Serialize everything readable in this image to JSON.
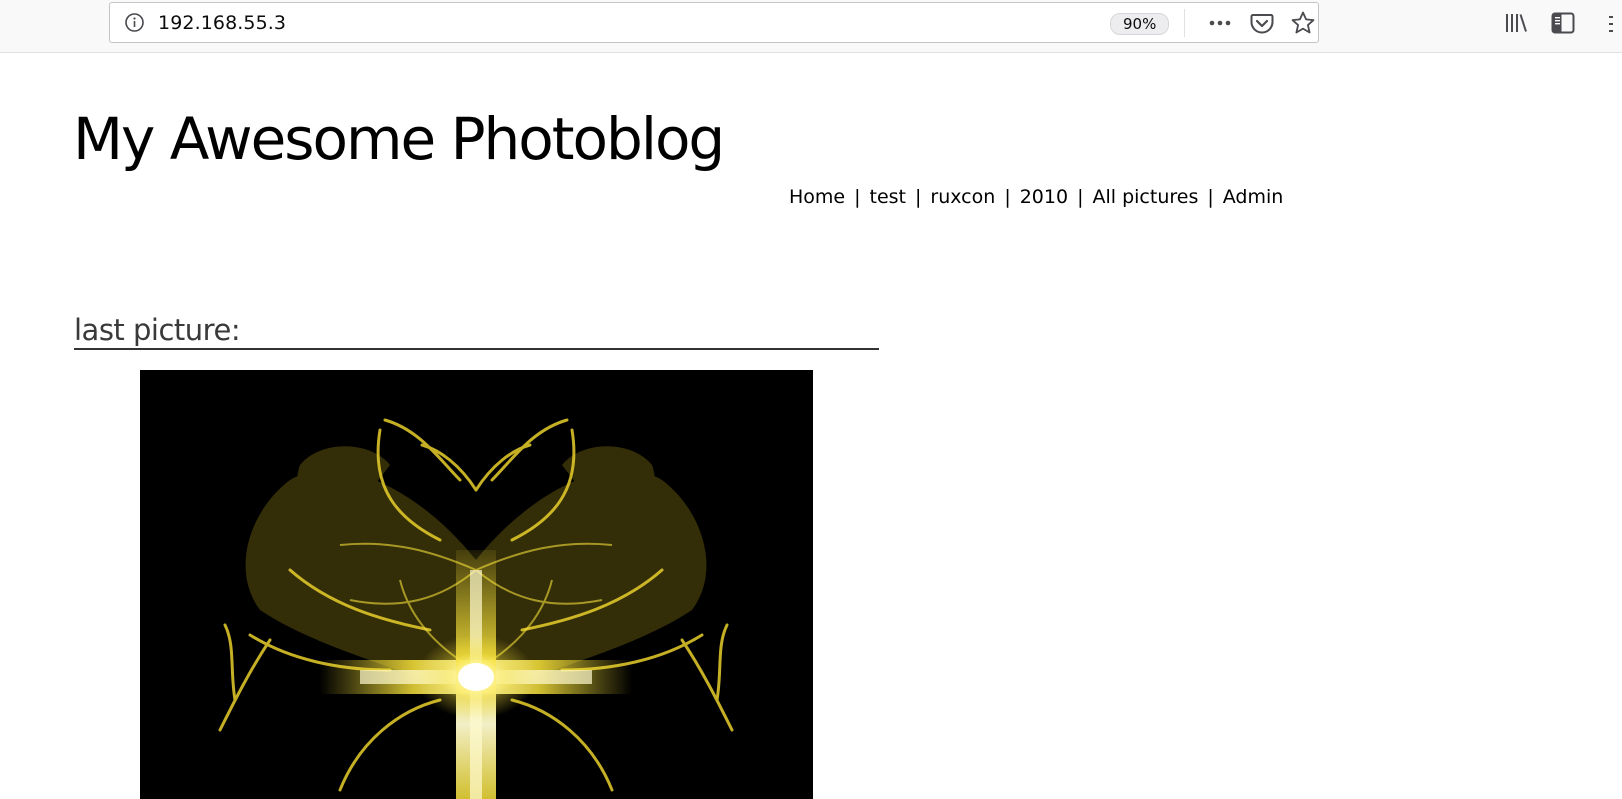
{
  "browser": {
    "url": "192.168.55.3",
    "zoom": "90%",
    "icons": {
      "site_info": "info-icon",
      "page_actions": "more-horizontal-icon",
      "pocket": "pocket-icon",
      "bookmark": "star-icon",
      "library": "library-icon",
      "sidebar": "sidebar-icon",
      "menu": "hamburger-menu-icon"
    }
  },
  "site": {
    "title": "My Awesome Photoblog",
    "nav": [
      {
        "label": "Home"
      },
      {
        "label": "test"
      },
      {
        "label": "ruxcon"
      },
      {
        "label": "2010"
      },
      {
        "label": "All pictures"
      },
      {
        "label": "Admin"
      }
    ],
    "nav_separator": "|",
    "section_heading": "last picture:",
    "photo": {
      "description_icon": "photo-image",
      "background": "#000000",
      "accent": "#f5e03a"
    }
  }
}
